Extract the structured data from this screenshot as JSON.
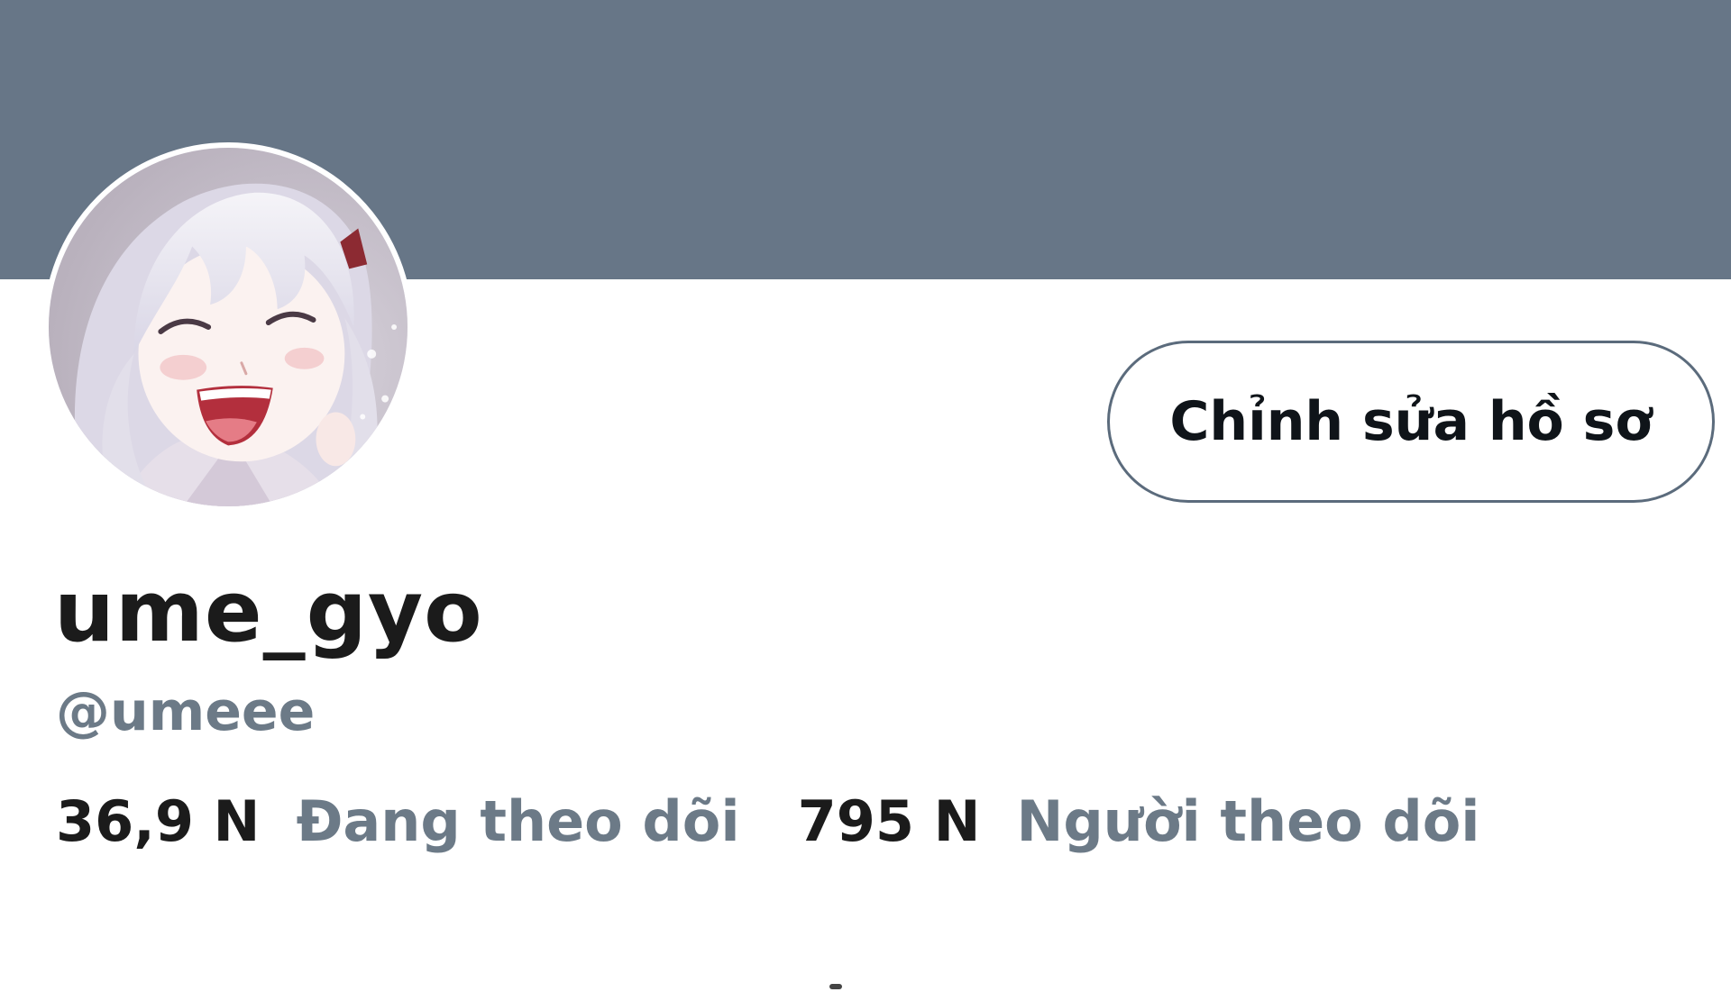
{
  "colors": {
    "banner": "#677687",
    "text_primary": "#1b1b1b",
    "text_secondary": "#6c7a87",
    "button_border": "#5b6b7c"
  },
  "profile": {
    "avatar_icon": "anime-girl-avatar",
    "display_name": "ume_gyo",
    "handle": "@umeee",
    "edit_button_label": "Chỉnh sửa hồ sơ"
  },
  "stats": {
    "following_count": "36,9 N",
    "following_label": "Đang theo dõi",
    "followers_count": "795 N",
    "followers_label": "Người theo dõi"
  }
}
